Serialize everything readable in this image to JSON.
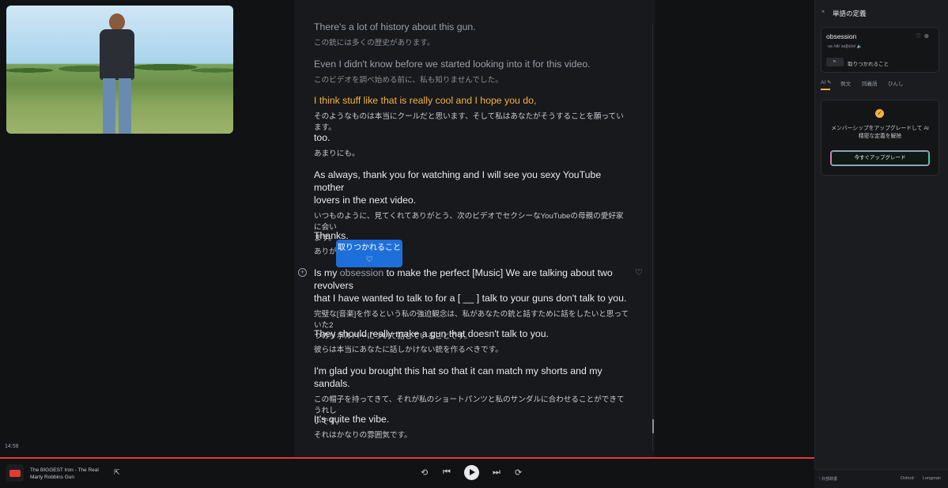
{
  "video": {
    "alt": "video-player"
  },
  "timestamp": "14:58",
  "transcript": [
    {
      "en": "There's a lot of history about this gun.",
      "jp": "この銃には多くの歴史があります。"
    },
    {
      "en": "Even I didn't know before we started looking into it for this video.",
      "jp": "このビデオを調べ始める前に、私も知りませんでした。"
    },
    {
      "en": "I think stuff like that is really cool and I hope you do,",
      "jp": "そのようなものは本当にクールだと思います、そして私はあなたがそうすることを願っています。"
    },
    {
      "en": "too.",
      "jp": "あまりにも。"
    },
    {
      "en1": "As always, thank you for watching and I will see you sexy YouTube mother",
      "en2": "lovers in the next video.",
      "jp1": "いつものように、見てくれてありがとう、次のビデオでセクシーなYouTubeの母親の愛好家に会い",
      "jp2": "ます。"
    },
    {
      "en": "Thanks.",
      "jp": "ありが"
    },
    {
      "en1_pre": "Is my ",
      "en1_word": "obsession",
      "en1_post": " to make the perfect [Music] We are talking about two revolvers",
      "en2": "that I have wanted to talk to for a [ __ ] talk to your guns don't talk to you.",
      "jp1": "完璧な[音楽]を作るという私の強迫観念は、私があなたの銃と話すために話をしたいと思っていた2",
      "jp2": "つのリボルバーについて話していることです。"
    },
    {
      "en": "They should really make a gun that doesn't talk to you.",
      "jp": "彼らは本当にあなたに話しかけない銃を作るべきです。"
    },
    {
      "en": "I'm glad you brought this hat so that it can match my shorts and my sandals.",
      "jp1": "この帽子を持ってきて、それが私のショートパンツと私のサンダルに合わせることができてうれし",
      "jp2": "いです。"
    },
    {
      "en": "It's quite the vibe.",
      "jp": "それはかなりの雰囲気です。"
    }
  ],
  "popup": {
    "word": "取りつかれること",
    "heart": "♡"
  },
  "row_icons": {
    "plus": "+",
    "heart": "♡"
  },
  "player": {
    "track_title_1": "The BIGGEST Iron - The Real",
    "track_title_2": "Marty Robbins Gun",
    "external_icon": "⇱",
    "repeat_icon": "⟲",
    "prev_icon": "⏮",
    "next_icon": "⏭",
    "speed_icon": "⟳"
  },
  "panel": {
    "close": "×",
    "title": "単語の定義",
    "word": "obsession",
    "icons": "♡⊕",
    "phonetic": "us  /əbˈseʃ(ə)n/ 🔈",
    "pos": "n.",
    "definition": "取りつかれること",
    "tabs": [
      "AI ✎",
      "例文",
      "同義語",
      "ひんし"
    ],
    "badge": "✓",
    "upgrade_text": "メンバーシップをアップグレードして AI 精密な定義を解除",
    "upgrade_button": "今すぐアップグレード",
    "footer_left": "⁝ 外部辞書",
    "footer_oxford": "Oxford",
    "footer_longman": "Longman"
  }
}
